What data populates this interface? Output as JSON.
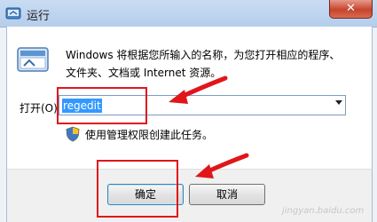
{
  "window": {
    "title": "运行",
    "close_label": "✕"
  },
  "description": {
    "line1": "Windows 将根据您所输入的名称，为您打开相应的程序、",
    "line2": "文件夹、文档或 Internet 资源。"
  },
  "open_field": {
    "label": "打开(O):",
    "value": "regedit"
  },
  "admin_note": "使用管理权限创建此任务。",
  "buttons": {
    "ok": "确定",
    "cancel": "取消"
  },
  "watermark": "jingyan.baidu.com",
  "colors": {
    "annotation_red": "#e0161b",
    "selection_blue": "#3399ff"
  },
  "icons": [
    "run-program-icon",
    "run-window-icon",
    "shield-icon",
    "dropdown-arrow-icon",
    "annotation-arrow-icon"
  ]
}
